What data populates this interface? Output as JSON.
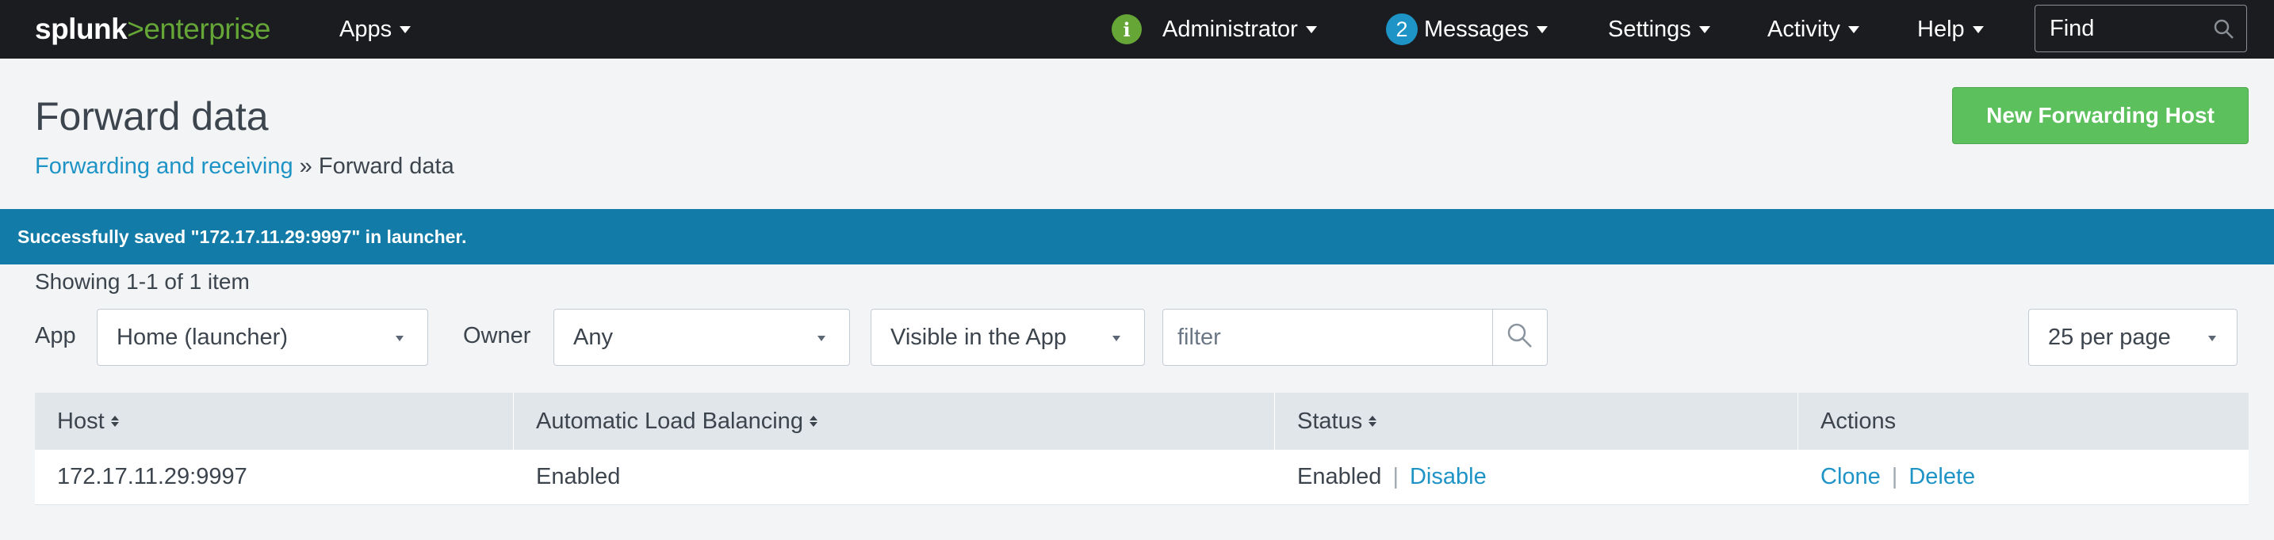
{
  "topbar": {
    "logo": {
      "part1": "splunk",
      "part2": ">",
      "part3": "enterprise"
    },
    "apps_label": "Apps",
    "user_label": "Administrator",
    "messages_count": "2",
    "messages_label": "Messages",
    "settings_label": "Settings",
    "activity_label": "Activity",
    "help_label": "Help",
    "find_placeholder": "Find",
    "info_glyph": "i"
  },
  "header": {
    "title": "Forward data",
    "breadcrumb_link": "Forwarding and receiving",
    "breadcrumb_sep": " » ",
    "breadcrumb_current": "Forward data",
    "new_button": "New Forwarding Host"
  },
  "banner": {
    "message": "Successfully saved \"172.17.11.29:9997\" in launcher."
  },
  "filters": {
    "showing": "Showing 1-1 of 1 item",
    "app_label": "App",
    "app_value": "Home (launcher)",
    "owner_label": "Owner",
    "owner_value": "Any",
    "visibility_value": "Visible in the App",
    "filter_placeholder": "filter",
    "per_page": "25 per page"
  },
  "table": {
    "columns": [
      "Host",
      "Automatic Load Balancing",
      "Status",
      "Actions"
    ],
    "rows": [
      {
        "host": "172.17.11.29:9997",
        "load_balancing": "Enabled",
        "status": "Enabled",
        "status_action": "Disable",
        "actions": [
          "Clone",
          "Delete"
        ]
      }
    ]
  },
  "colors": {
    "topbar": "#1a1c20",
    "accent_green": "#65a637",
    "button_green": "#5cc05c",
    "link_blue": "#1e93c6",
    "banner_blue": "#137ba7"
  }
}
